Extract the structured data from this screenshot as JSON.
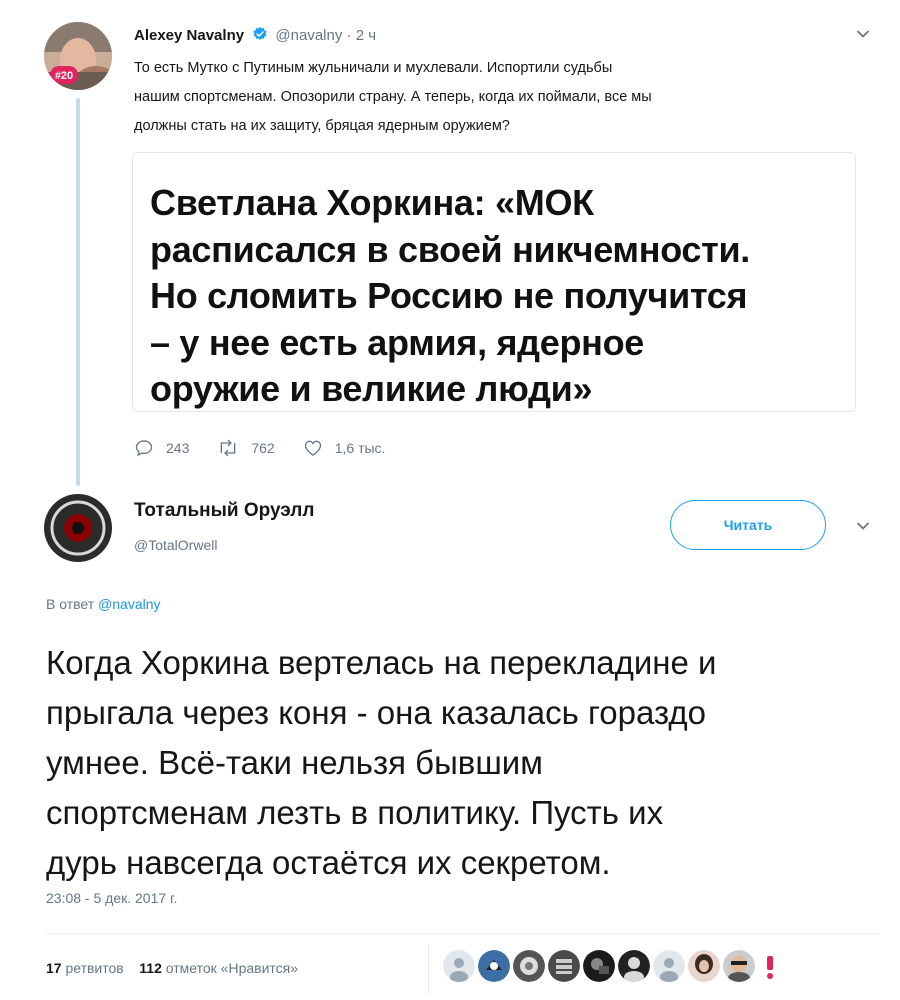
{
  "parent_tweet": {
    "author_name": "Alexey Navalny",
    "handle": "@navalny",
    "time": "2 ч",
    "badge": "#20",
    "text_lines": [
      "То есть Мутко с Путиным жульничали и мухлевали. Испортили судьбы",
      "нашим спортсменам. Опозорили страну. А теперь, когда их поймали, все мы",
      "должны стать на их защиту, бряцая ядерным оружием?"
    ],
    "card_lines": [
      "Светлана Хоркина: «МОК",
      "расписался в своей никчемности.",
      "Но сломить Россию не получится",
      "– у нее есть армия, ядерное",
      "оружие и великие люди»"
    ],
    "replies": "243",
    "retweets": "762",
    "likes": "1,6 тыс."
  },
  "main_tweet": {
    "author_name": "Тотальный Оруэлл",
    "handle": "@TotalOrwell",
    "follow_label": "Читать",
    "reply_prefix": "В ответ",
    "reply_mention": "@navalny",
    "text_lines": [
      "Когда Хоркина вертелась на перекладине и",
      "прыгала через коня - она казалась гораздо",
      "умнее. Всё-таки нельзя бывшим",
      "спортсменам лезть в политику. Пусть их",
      "дурь навсегда остаётся их секретом."
    ],
    "timestamp": "23:08 - 5 дек. 2017 г.",
    "retweets_count": "17",
    "retweets_label": "ретвитов",
    "likes_count": "112",
    "likes_label": "отметок «Нравится»"
  },
  "icons": {
    "verified": "verified-badge-icon",
    "chevron": "chevron-down-icon",
    "reply": "reply-icon",
    "retweet": "retweet-icon",
    "like": "heart-icon"
  },
  "colors": {
    "accent": "#1da1f2",
    "thread_line": "#c4dbe9",
    "muted_text": "#657786",
    "badge_red": "#e0245e"
  }
}
